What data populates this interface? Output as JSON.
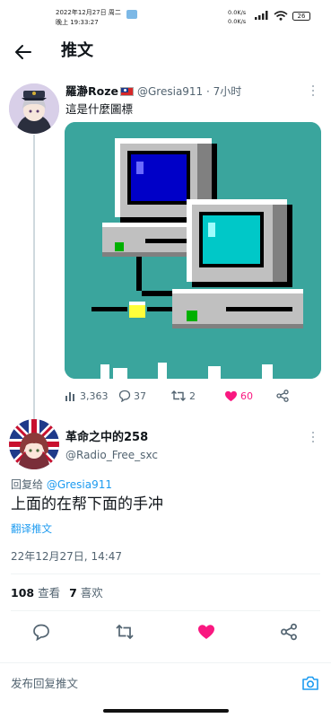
{
  "status_bar": {
    "datetime": "2022年12月27日 周二\n晚上 19:33:27",
    "net_speed": "0.0K/s\n0.0K/s",
    "battery": "26"
  },
  "header": {
    "title": "推文"
  },
  "tweet": {
    "author_name": "羅瀞Roze",
    "meta": "@Gresia911 · 7小时",
    "text": "這是什麼圖標",
    "views": "3,363",
    "replies": "37",
    "retweets": "2",
    "likes": "60"
  },
  "reply": {
    "author_name": "革命之中的258",
    "handle": "@Radio_Free_sxc",
    "replying_prefix": "回复给 ",
    "replying_to": "@Gresia911",
    "text": "上面的在帮下面的手冲",
    "translate": "翻译推文",
    "timestamp": "22年12月27日, 14:47",
    "views_count": "108",
    "views_label": "查看",
    "likes_count": "7",
    "likes_label": "喜欢"
  },
  "compose": {
    "placeholder": "发布回复推文"
  },
  "colors": {
    "accent": "#1d9bf0",
    "like": "#f91880",
    "muted": "#536471",
    "image_bg": "#3aa59d"
  }
}
